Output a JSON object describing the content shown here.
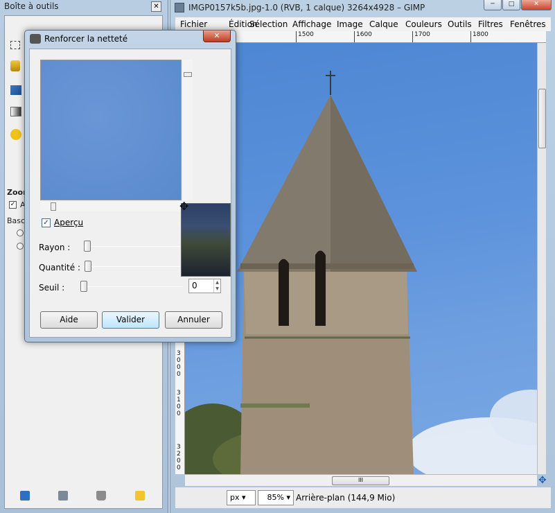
{
  "toolbox": {
    "title": "Boîte à outils",
    "close_glyph": "✕",
    "options": {
      "zoom_label": "Zoom",
      "auto_label": "A",
      "bascule_label": "Bascu"
    }
  },
  "gimp_window": {
    "title": "IMGP0157k5b.jpg-1.0 (RVB, 1 calque) 3264x4928 – GIMP",
    "minimize_glyph": "─",
    "maximize_glyph": "□",
    "close_glyph": "✕",
    "menu": [
      "Fichier",
      "Édition",
      "Sélection",
      "Affichage",
      "Image",
      "Calque",
      "Couleurs",
      "Outils",
      "Filtres",
      "Fenêtres"
    ],
    "ruler_ticks": [
      "1500",
      "1600",
      "1700",
      "1800"
    ],
    "ruler_vertical": [
      "3",
      "0",
      "0",
      "0",
      "3",
      "1",
      "0",
      "0",
      "3",
      "2",
      "0",
      "0"
    ],
    "hscroll_grip": "III",
    "unit": "px",
    "zoom": "85%",
    "status": "Arrière-plan (144,9 Mio)",
    "nav_icon": "✥"
  },
  "dialog": {
    "title": "Renforcer la netteté",
    "close_glyph": "✕",
    "apercu_label": "Aperçu",
    "apercu_checked": true,
    "rayon_label": "Rayon :",
    "quantite_label": "Quantité :",
    "seuil_label": "Seuil :",
    "seuil_value": "0",
    "buttons": {
      "aide": "Aide",
      "valider": "Valider",
      "annuler": "Annuler"
    }
  },
  "icons": {
    "move_cursor": "✥",
    "checkmark": "✓"
  }
}
